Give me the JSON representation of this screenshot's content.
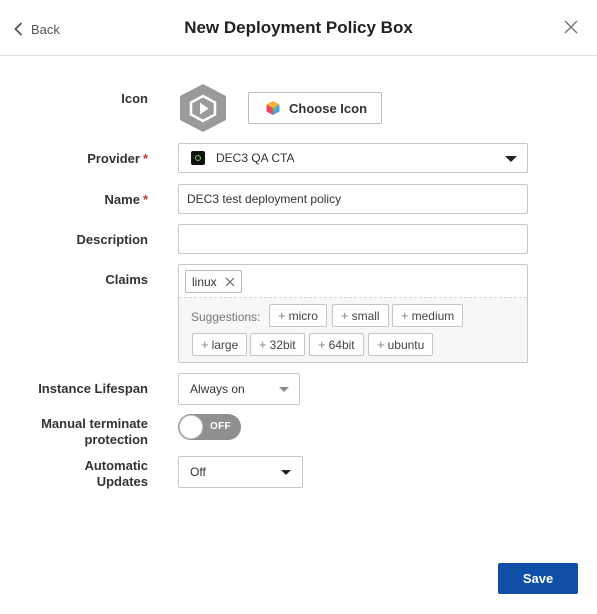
{
  "header": {
    "back_label": "Back",
    "title": "New Deployment Policy Box"
  },
  "form": {
    "icon": {
      "label": "Icon",
      "button_label": "Choose Icon"
    },
    "provider": {
      "label": "Provider",
      "required_mark": "*",
      "value": "DEC3 QA CTA"
    },
    "name": {
      "label": "Name",
      "required_mark": "*",
      "value": "DEC3 test deployment policy"
    },
    "description": {
      "label": "Description",
      "value": ""
    },
    "claims": {
      "label": "Claims",
      "tags": [
        "linux"
      ],
      "suggestions_label": "Suggestions:",
      "suggestions": [
        "micro",
        "small",
        "medium",
        "large",
        "32bit",
        "64bit",
        "ubuntu"
      ]
    },
    "instance_lifespan": {
      "label": "Instance Lifespan",
      "value": "Always on"
    },
    "manual_terminate": {
      "label_line1": "Manual terminate",
      "label_line2": "protection",
      "toggle_text": "OFF",
      "enabled": false
    },
    "automatic_updates": {
      "label_line1": "Automatic",
      "label_line2": "Updates",
      "value": "Off"
    }
  },
  "footer": {
    "save_label": "Save"
  },
  "colors": {
    "primary": "#0f4fa8",
    "required": "#c0392b",
    "toggle_off": "#8f8f8f",
    "icon_hex": "#9a9a9a"
  }
}
